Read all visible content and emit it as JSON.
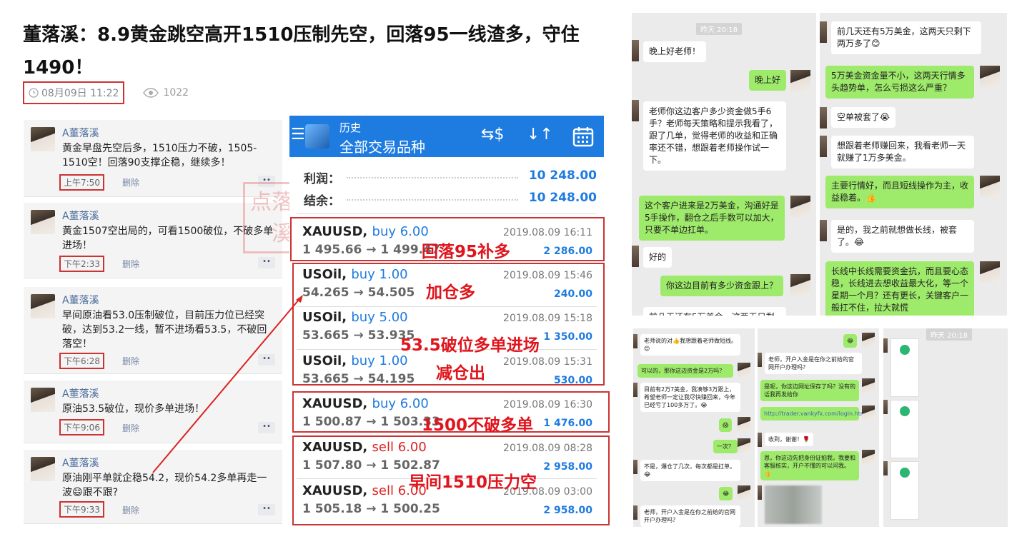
{
  "article": {
    "title": "董落溪：8.9黄金跳空高开1510压制先空，回落95一线渣多，守住1490！",
    "date": "08月09日 11:22",
    "views": "1022"
  },
  "posts": [
    {
      "name": "A董落溪",
      "text": "黄金早盘先空后多，1510压力不破，1505-1510空！回落90支撑企稳，继续多！",
      "time": "上午7:50",
      "delete": "删除"
    },
    {
      "name": "A董落溪",
      "text": "黄金1507空出局的，可看1500破位，不破多单进场！",
      "time": "下午2:33",
      "delete": "删除"
    },
    {
      "name": "A董落溪",
      "text": "早间原油看53.0压制破位，目前压力位已经突破，达到53.2一线，暂不进场看53.5，不破回落空！",
      "time": "下午6:28",
      "delete": "删除"
    },
    {
      "name": "A董落溪",
      "text": "原油53.5破位，现价多单进场！",
      "time": "下午9:06",
      "delete": "删除"
    },
    {
      "name": "A董落溪",
      "text": "原油刚平单就企稳54.2，现价54.2多单再走一波😄跟不跟?",
      "time": "下午9:33",
      "delete": "删除"
    }
  ],
  "watermark": "点落金溪",
  "app": {
    "menu_icon": "hamburger-icon",
    "subtitle": "历史",
    "title": "全部交易品种",
    "profit_label": "利润：",
    "profit_value": "10 248.00",
    "balance_label": "结余：",
    "balance_value": "10 248.00",
    "accent": "#1e7be0",
    "trades": [
      {
        "symbol": "XAUUSD,",
        "side": "buy 6.00",
        "dir": "buy",
        "prices": "1 495.66 → 1 499.47",
        "datetime": "2019.08.09 16:11",
        "profit": "2 286.00"
      },
      {
        "symbol": "USOil,",
        "side": "buy 1.00",
        "dir": "buy",
        "prices": "54.265 → 54.505",
        "datetime": "2019.08.09 15:46",
        "profit": "240.00"
      },
      {
        "symbol": "USOil,",
        "side": "buy 5.00",
        "dir": "buy",
        "prices": "53.665 → 53.935",
        "datetime": "2019.08.09 15:18",
        "profit": "1 350.00"
      },
      {
        "symbol": "USOil,",
        "side": "buy 1.00",
        "dir": "buy",
        "prices": "53.665 → 54.195",
        "datetime": "2019.08.09 15:31",
        "profit": "530.00"
      },
      {
        "symbol": "XAUUSD,",
        "side": "buy 6.00",
        "dir": "buy",
        "prices": "1 500.87 → 1 503.33",
        "datetime": "2019.08.09 16:30",
        "profit": "1 476.00"
      },
      {
        "symbol": "XAUUSD,",
        "side": "sell 6.00",
        "dir": "sell",
        "prices": "1 507.80 → 1 502.87",
        "datetime": "2019.08.09 08:28",
        "profit": "2 958.00"
      },
      {
        "symbol": "XAUUSD,",
        "side": "sell 6.00",
        "dir": "sell",
        "prices": "1 505.18 → 1 500.25",
        "datetime": "2019.08.09 03:00",
        "profit": "2 958.00"
      }
    ]
  },
  "annotations": {
    "n1": "回落95补多",
    "n2": "加仓多",
    "n3": "53.5破位多单进场",
    "n4": "减仓出",
    "n5": "1500不破多单",
    "n6": "早间1510压力空"
  },
  "chat1": {
    "timestamp": "昨天 20:18",
    "messages": [
      "晚上好老师！",
      "晚上好",
      "老师你这边客户多少资金做5手6手？老师每天策略和提示我看了，跟了几单，觉得老师的收益和正确率还不错，想跟着老师操作试一下。",
      "这个客户进来是2万美金，沟通好是5手操作，翻仓之后手数可以加大，只要不单边扛单。",
      "好的",
      "你这边目前有多少资金跟上？",
      "前几天还有5万美金，这两天只剩下"
    ]
  },
  "chat2": {
    "messages": [
      "前几天还有5万美金，这两天只剩下两万多了😊",
      "5万美金资金量不小，这两天行情多头趋势单，怎么亏损这么严重？",
      "空单被套了😭",
      "想跟着老师赚回来，我看老师一天就赚了1万多美金。",
      "主要行情好，而且短线操作为主，收益稳着。👍",
      "是的，我之前就想做长线，被套了。😂",
      "长线中长线需要资金抗，而且要心态稳，长线进去想收益最大化，等一个星期一个月？还有更长，关键客户一般扛不住，拉大就慌"
    ]
  },
  "chat3": {
    "messages": [
      "老师说的对👍我想跟着老师做短线。😊",
      "可以的，那你这边资金是2万吗？",
      "目前有2万7美金，我凑够3万跟上，希望老师一定让我尽快赚回来，今年已经亏了100多万了。😭",
      "😱",
      "一次？",
      "不是，爆仓了几次，每次都是扛单。😂",
      "😂",
      "老师，开户入金是在你之前给的官网开户办理吗？"
    ]
  },
  "chat4": {
    "messages": [
      "😂",
      "老师，开户入金是在你之前给的官网开户办理吗？",
      "是呢，你这边网址保存了吗？没有的话我再发给你",
      "http://trader.vankyfx.com/login.html",
      "收到，谢谢！🌹",
      "恩，你这边先把身份证拍我，我要和客服核实，开户不懂的可以问我。👍"
    ]
  },
  "chat5": {
    "timestamp": "昨天 20:18"
  }
}
